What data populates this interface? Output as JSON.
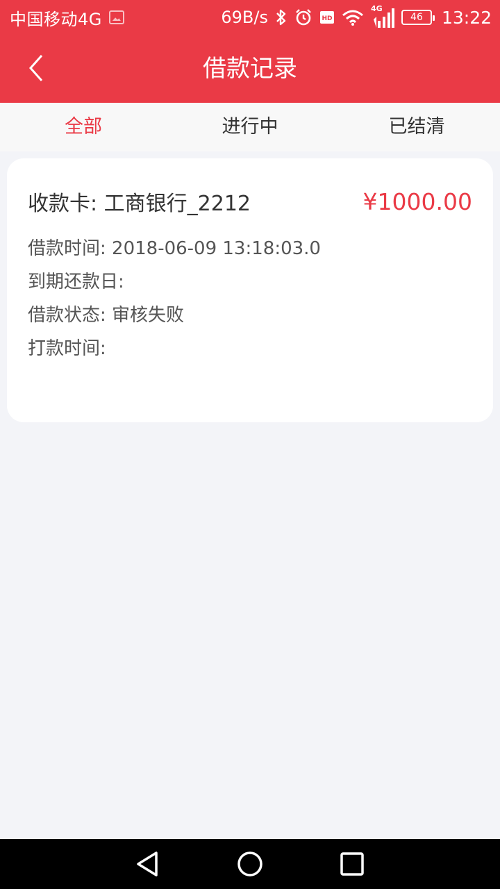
{
  "status_bar": {
    "carrier": "中国移动4G",
    "net_speed": "69B/s",
    "network": "4G",
    "battery": "46",
    "time": "13:22"
  },
  "header": {
    "title": "借款记录",
    "back_icon": "chevron-left-icon"
  },
  "tabs": [
    {
      "label": "全部",
      "active": true
    },
    {
      "label": "进行中",
      "active": false
    },
    {
      "label": "已结清",
      "active": false
    }
  ],
  "loan_record": {
    "card_label": "收款卡: 工商银行_2212",
    "amount": "¥1000.00",
    "loan_time": "借款时间: 2018-06-09 13:18:03.0",
    "due_date": "到期还款日:",
    "status": "借款状态: 审核失败",
    "payout_time": "打款时间:"
  },
  "colors": {
    "accent": "#ea3a46",
    "background": "#f3f4f8"
  }
}
